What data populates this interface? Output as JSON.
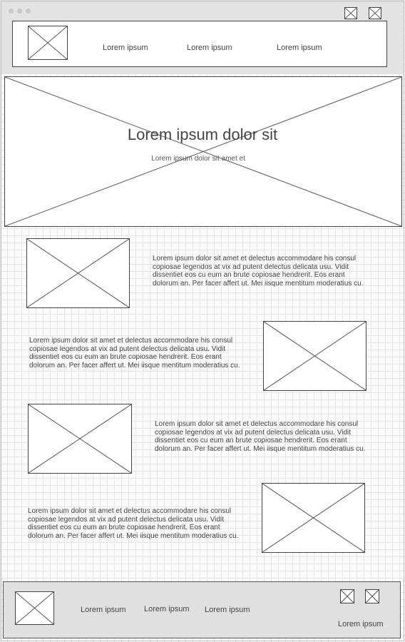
{
  "nav": {
    "links": [
      "Lorem ipsum",
      "Lorem ipsum",
      "Lorem ipsum"
    ]
  },
  "hero": {
    "title": "Lorem ipsum dolor sit",
    "subtitle": "Lorem ipsum dolor sit amet et"
  },
  "content": {
    "rows": [
      {
        "text": "Lorem ipsum dolor sit amet et delectus accommodare his consul copiosae legendos at vix ad putent delectus delicata usu. Vidit dissentiet eos cu eum an brute copiosae hendrerit. Eos erant dolorum an. Per facer affert ut. Mei iisque mentitum moderatius cu."
      },
      {
        "text": "Lorem ipsum dolor sit amet et delectus accommodare his consul copiosae legendos at vix ad putent delectus delicata usu. Vidit dissentiet eos cu eum an brute copiosae hendrerit. Eos erant dolorum an. Per facer affert ut. Mei iisque mentitum moderatius cu."
      },
      {
        "text": "Lorem ipsum dolor sit amet et delectus accommodare his consul copiosae legendos at vix ad putent delectus delicata usu. Vidit dissentiet eos cu eum an brute copiosae hendrerit. Eos erant dolorum an. Per facer affert ut. Mei iisque mentitum moderatius cu."
      },
      {
        "text": "Lorem ipsum dolor sit amet et delectus accommodare his consul copiosae legendos at vix ad putent delectus delicata usu. Vidit dissentiet eos cu eum an brute copiosae hendrerit. Eos erant dolorum an. Per facer affert ut. Mei iisque mentitum moderatius cu."
      }
    ]
  },
  "footer": {
    "links": [
      "Lorem ipsum",
      "Lorem ipsum",
      "Lorem ipsum"
    ],
    "bottom_link": "Lorem ipsum"
  },
  "icons": {
    "placeholder": "image-placeholder-icon",
    "window_dots": "window-control-dots"
  }
}
